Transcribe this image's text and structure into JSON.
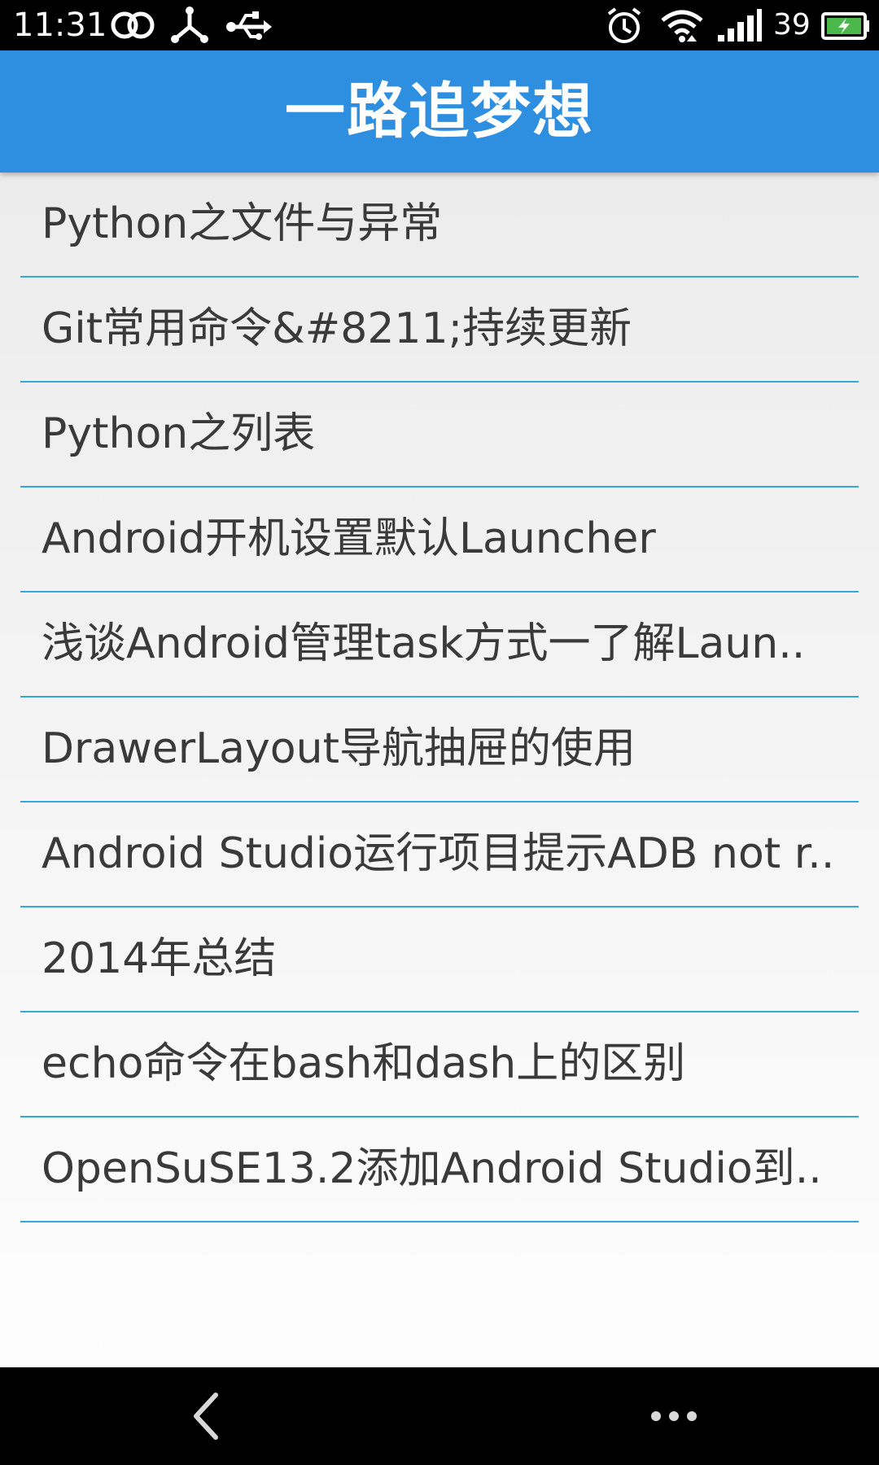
{
  "status_bar": {
    "time": "11:31",
    "battery_level": "39",
    "icons": [
      "infinity-link-icon",
      "usb-debug-icon",
      "usb-icon",
      "alarm-icon",
      "wifi-icon",
      "signal-icon",
      "battery-charging-icon"
    ]
  },
  "app_bar": {
    "title": "一路追梦想",
    "color": "#2e8ee0"
  },
  "list": {
    "divider_color": "#34a9d9",
    "items": [
      {
        "title": "Python之文件与异常"
      },
      {
        "title": "Git常用命令&#8211;持续更新"
      },
      {
        "title": "Python之列表"
      },
      {
        "title": "Android开机设置默认Launcher"
      },
      {
        "title": "浅谈Android管理task方式一了解Laun.."
      },
      {
        "title": "DrawerLayout导航抽屉的使用"
      },
      {
        "title": "Android Studio运行项目提示ADB not r.."
      },
      {
        "title": "2014年总结"
      },
      {
        "title": "echo命令在bash和dash上的区别"
      },
      {
        "title": "OpenSuSE13.2添加Android Studio到.."
      }
    ]
  },
  "nav_bar": {
    "icons": [
      "back-icon",
      "more-icon"
    ]
  }
}
